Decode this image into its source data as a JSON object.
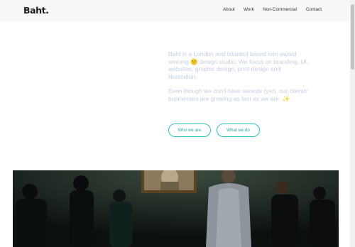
{
  "header": {
    "logo": "Baht.",
    "nav": [
      {
        "label": "About"
      },
      {
        "label": "Work"
      },
      {
        "label": "Non-Commercial"
      },
      {
        "label": "Contact"
      }
    ]
  },
  "intro": {
    "p1_a": "Baht is a London and Istanbul based non-award winning",
    "p1_emoji": "🙂",
    "p1_b": "design studio. We focus on branding, UI, websites, graphic design, print design and illustration.",
    "p2_a": "Even though we don't have awards (yet), our clients' businesses are growing as fast as we are.",
    "p2_emoji": "✨"
  },
  "buttons": {
    "who": "Who we are",
    "what": "What we do"
  },
  "hero": {
    "icon": "gallery-photo-people-viewing-painting"
  },
  "colors": {
    "accent": "#2ec4bd",
    "intro_text": "#c4d0e1",
    "header_bg": "#f7f7f7"
  }
}
